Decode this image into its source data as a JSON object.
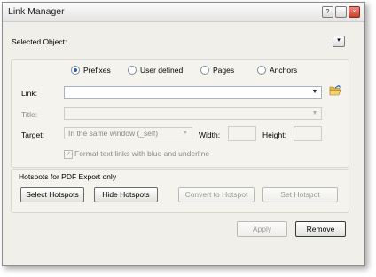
{
  "window": {
    "title": "Link Manager",
    "buttons": [
      "help",
      "minimize",
      "close"
    ]
  },
  "selected_object": {
    "label": "Selected Object:",
    "button_label": "▾"
  },
  "link_types": [
    {
      "label": "Prefixes",
      "selected": true
    },
    {
      "label": "User defined",
      "selected": false
    },
    {
      "label": "Pages",
      "selected": false
    },
    {
      "label": "Anchors",
      "selected": false
    }
  ],
  "form": {
    "link_label": "Link:",
    "link_value": "",
    "title_label": "Title:",
    "title_value": "",
    "target_label": "Target:",
    "target_value": "In the same window (_self)",
    "width_label": "Width:",
    "width_value": "",
    "height_label": "Height:",
    "height_value": "",
    "format_label": "Format text links with blue and underline",
    "format_checked": true
  },
  "hotspots": {
    "section_label": "Hotspots for PDF Export only",
    "select_label": "Select Hotspots",
    "hide_label": "Hide Hotspots",
    "convert_label": "Convert to Hotspot",
    "set_label": "Set Hotspot"
  },
  "footer": {
    "apply_label": "Apply",
    "remove_label": "Remove"
  },
  "icons": {
    "help": "help-icon",
    "minimize": "minimize-icon",
    "close": "close-icon",
    "browse": "folder-open-icon"
  }
}
